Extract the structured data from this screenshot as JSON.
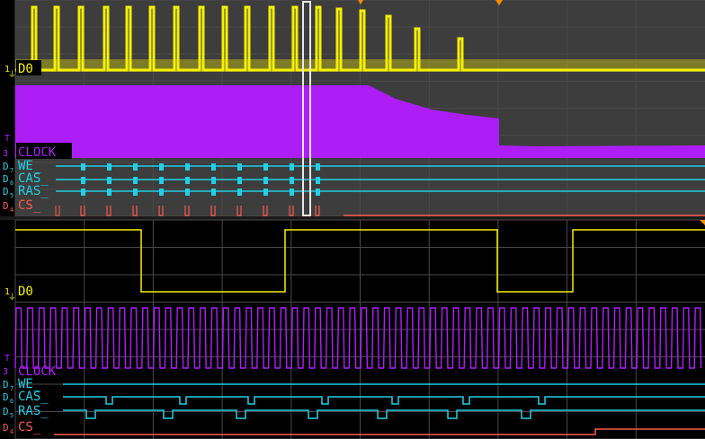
{
  "colors": {
    "d0": "#f5f000",
    "clock": "#b21cff",
    "digital": "#20d0e8",
    "cs": "#ff5a4a",
    "grid": "#4a4a4a",
    "bg_zoom": "#3d3d3d",
    "bg_main": "#000000",
    "marker": "#ff8a00"
  },
  "overview": {
    "channels": {
      "d0": {
        "index": "1",
        "label": "D0"
      },
      "clock": {
        "index": "3",
        "label": "CLOCK"
      }
    },
    "digital": [
      {
        "prefix": "D",
        "index": "7",
        "label": "WE_"
      },
      {
        "prefix": "D",
        "index": "6",
        "label": "CAS_"
      },
      {
        "prefix": "D",
        "index": "5",
        "label": "RAS_"
      },
      {
        "prefix": "D",
        "index": "4",
        "label": "CS_"
      }
    ],
    "trigger_marker": "T"
  },
  "main": {
    "channels": {
      "d0": {
        "index": "1",
        "label": "D0"
      },
      "clock": {
        "index": "3",
        "label": "CLOCK"
      }
    },
    "digital": [
      {
        "prefix": "D",
        "index": "7",
        "label": "WE_"
      },
      {
        "prefix": "D",
        "index": "6",
        "label": "CAS_"
      },
      {
        "prefix": "D",
        "index": "5",
        "label": "RAS_"
      },
      {
        "prefix": "D",
        "index": "4",
        "label": "CS_"
      }
    ],
    "trigger_marker": "T"
  }
}
